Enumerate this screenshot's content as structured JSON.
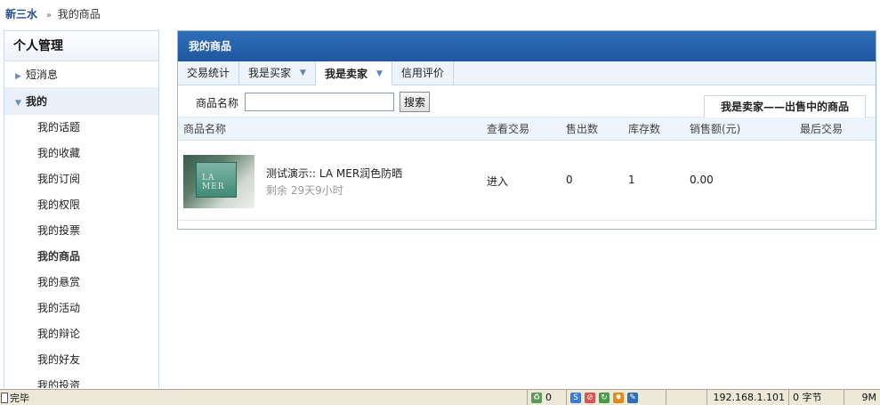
{
  "breadcrumb": {
    "home": "新三水",
    "separator": "»",
    "current": "我的商品"
  },
  "sidebar": {
    "title": "个人管理",
    "groups": [
      {
        "label": "短消息",
        "expanded": false
      },
      {
        "label": "我的",
        "expanded": true
      }
    ],
    "items": [
      "我的话题",
      "我的收藏",
      "我的订阅",
      "我的权限",
      "我的投票",
      "我的商品",
      "我的悬赏",
      "我的活动",
      "我的辩论",
      "我的好友",
      "我的投资"
    ],
    "active_item": "我的商品"
  },
  "panel": {
    "title": "我的商品",
    "tabs": [
      {
        "label": "交易统计",
        "dropdown": false
      },
      {
        "label": "我是买家",
        "dropdown": true
      },
      {
        "label": "我是卖家",
        "dropdown": true
      },
      {
        "label": "信用评价",
        "dropdown": false
      }
    ],
    "active_tab": "我是卖家",
    "search": {
      "label": "商品名称",
      "value": "",
      "button": "搜索"
    },
    "seller_tab": "我是卖家——出售中的商品",
    "columns": [
      "商品名称",
      "查看交易",
      "售出数",
      "库存数",
      "销售额(元)",
      "最后交易"
    ],
    "rows": [
      {
        "name": "测试演示:: LA MER润色防晒",
        "remaining": "剩余 29天9小时",
        "view": "进入",
        "sold": "0",
        "stock": "1",
        "sales": "0.00",
        "last_trade": "",
        "thumb_text": "LA MER"
      }
    ]
  },
  "statusbar": {
    "status": "完毕",
    "counter": "0",
    "ip": "192.168.1.101",
    "bytes": "0 字节",
    "memory": "9M"
  },
  "colors": {
    "header": "#1f56a0",
    "tab_bg": "#eef4fb",
    "border": "#9fb6d2",
    "statusbar": "#ece9d8"
  }
}
